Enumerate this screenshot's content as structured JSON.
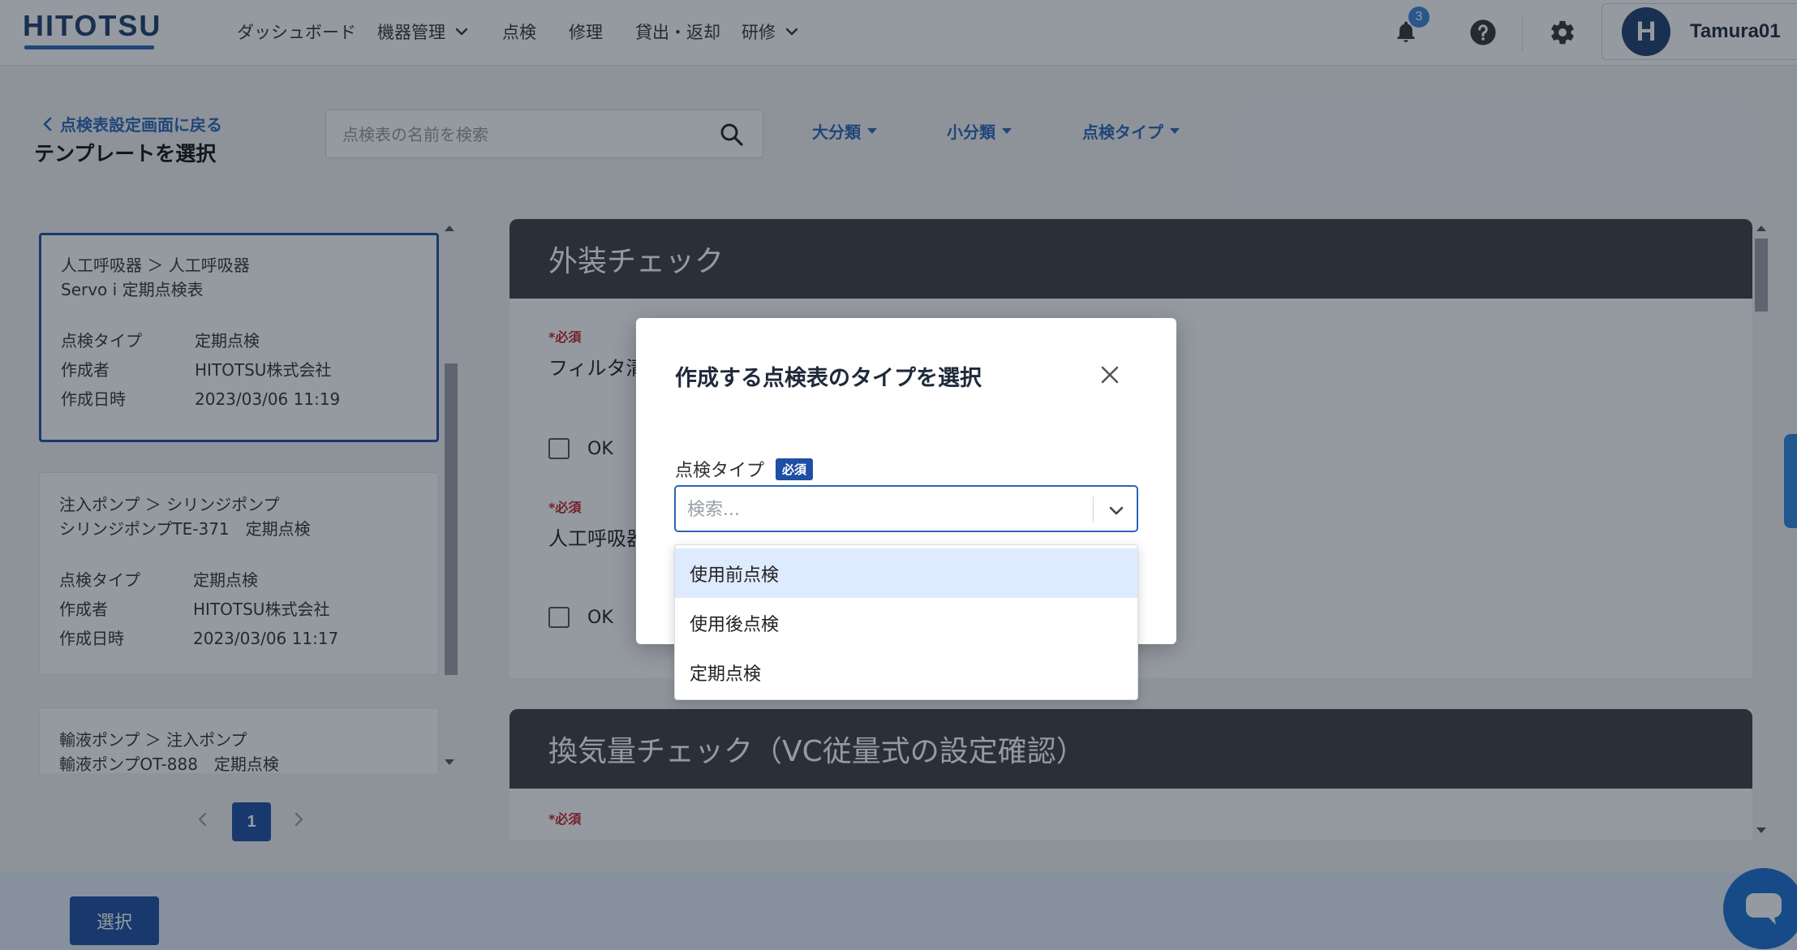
{
  "app": {
    "logo": "HITOTSU",
    "colors": {
      "brand": "#1e3f6e",
      "accent": "#2a66b8",
      "primary_button": "#1e4fa5",
      "required": "#c0262d",
      "section_header": "#3c3e43"
    }
  },
  "nav": {
    "items": [
      {
        "label": "ダッシュボード",
        "dropdown": false
      },
      {
        "label": "機器管理",
        "dropdown": true
      },
      {
        "label": "点検",
        "dropdown": false
      },
      {
        "label": "修理",
        "dropdown": false
      },
      {
        "label": "貸出・返却",
        "dropdown": false
      },
      {
        "label": "研修",
        "dropdown": true
      }
    ],
    "notification_count": "3",
    "user": {
      "initial": "H",
      "name": "Tamura01"
    }
  },
  "toolbar": {
    "back_label": "点検表設定画面に戻る",
    "page_title": "テンプレートを選択",
    "search_placeholder": "点検表の名前を検索",
    "filters": [
      "大分類",
      "小分類",
      "点検タイプ"
    ]
  },
  "templates": [
    {
      "path": "人工呼吸器 ＞ 人工呼吸器",
      "name": "Servo i 定期点検表",
      "type_label": "点検タイプ",
      "type": "定期点検",
      "author_label": "作成者",
      "author": "HITOTSU株式会社",
      "date_label": "作成日時",
      "date": "2023/03/06 11:19",
      "selected": true
    },
    {
      "path": "注入ポンプ ＞ シリンジポンプ",
      "name": "シリンジポンプTE-371　定期点検",
      "type_label": "点検タイプ",
      "type": "定期点検",
      "author_label": "作成者",
      "author": "HITOTSU株式会社",
      "date_label": "作成日時",
      "date": "2023/03/06 11:17",
      "selected": false
    },
    {
      "path": "輸液ポンプ ＞ 注入ポンプ",
      "name": "輸液ポンプOT-888　定期点検",
      "selected": false
    }
  ],
  "pagination": {
    "current": "1"
  },
  "preview": {
    "sections": [
      {
        "title": "外装チェック",
        "questions": [
          {
            "required": "*必須",
            "text": "フィルタ清",
            "option": "OK"
          },
          {
            "required": "*必須",
            "text": "人工呼吸器",
            "option": "OK"
          }
        ]
      },
      {
        "title": "換気量チェック（VC従量式の設定確認）",
        "questions": [
          {
            "required": "*必須"
          }
        ]
      }
    ]
  },
  "footer": {
    "select_label": "選択"
  },
  "modal": {
    "title": "作成する点検表のタイプを選択",
    "field_label": "点検タイプ",
    "required_badge": "必須",
    "combo_placeholder": "検索...",
    "options": [
      "使用前点検",
      "使用後点検",
      "定期点検"
    ],
    "highlighted_option": "使用前点検"
  }
}
